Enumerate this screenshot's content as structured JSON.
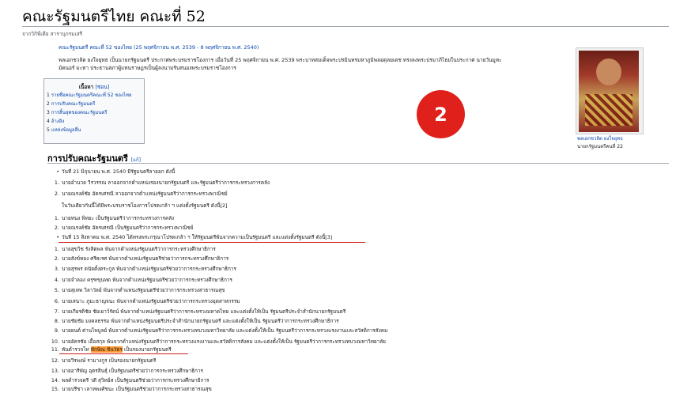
{
  "page": {
    "title": "คณะรัฐมนตรีไทย คณะที่ 52",
    "from": "จากวิกิพีเดีย สารานุกรมเสรี"
  },
  "intro": {
    "p1": "คณะรัฐมนตรี คณะที่ 52 ของไทย (25 พฤศจิกายน พ.ศ. 2539 - 8 พฤศจิกายน พ.ศ. 2540)",
    "p2a": "พลเอกชวลิต ยงใจยุทธ เป็นนายกรัฐมนตรี ประกาศพระบรมราชโองการ เมื่อวันที่ 25 พฤศจิกายน พ.ศ. 2539 พระบาทสมเด็จพระปรมินทรมหาภูมิพลอดุลยเดช ทรงลงพระปรมาภิไธยในประกาศ นายวันมูหะ",
    "p2b": "มัดนอร์ มะทา ประธานสภาผู้แทนราษฎรเป็นผู้ลงนามรับสนองพระบรมราชโองการ"
  },
  "toc": {
    "title": "เนื้อหา",
    "hide": "[ซ่อน]",
    "items": [
      {
        "num": "1",
        "label": "รายชื่อคณะรัฐมนตรีคณะที่ 52 ของไทย"
      },
      {
        "num": "2",
        "label": "การปรับคณะรัฐมนตรี"
      },
      {
        "num": "3",
        "label": "การสิ้นสุดของคณะรัฐมนตรี"
      },
      {
        "num": "4",
        "label": "อ้างอิง"
      },
      {
        "num": "5",
        "label": "แหล่งข้อมูลอื่น"
      }
    ]
  },
  "infobox": {
    "caption": "พลเอกชวลิต ยงใจยุทธ",
    "subcaption": "นายกรัฐมนตรีคนที่ 22"
  },
  "badge": {
    "number": "2"
  },
  "section": {
    "heading": "การปรับคณะรัฐมนตรี",
    "edit": "[แก้]"
  },
  "lines": [
    {
      "mark": "•",
      "text": "วันที่ 21 มิถุนายน พ.ศ. 2540 มีรัฐมนตรีลาออก ดังนี้",
      "kind": "bullet"
    },
    {
      "mark": "1.",
      "text": "นายอำนวย วีรวรรณ ลาออกจากตำแหน่งรองนายกรัฐมนตรี และรัฐมนตรีว่าการกระทรวงการคลัง",
      "kind": "num"
    },
    {
      "mark": "2.",
      "text": "นายณรงค์ชัย อัครเศรณี ลาออกจากตำแหน่งรัฐมนตรีว่าการกระทรวงพาณิชย์",
      "kind": "num"
    },
    {
      "mark": "",
      "text": "ในวันเดียวกันนี้ได้มีพระบรมราชโองการโปรดเกล้า ฯ แต่งตั้งรัฐมนตรี ดังนี้[2]",
      "kind": "plain"
    },
    {
      "mark": "1.",
      "text": "นายทนง พิทยะ เป็นรัฐมนตรีว่าการกระทรวงการคลัง",
      "kind": "num"
    },
    {
      "mark": "2.",
      "text": "นายณรงค์ชัย อัครเศรณี เป็นรัฐมนตรีว่าการกระทรวงพาณิชย์",
      "kind": "num"
    },
    {
      "mark": "•",
      "text": "วันที่ 15 สิงหาคม พ.ศ. 2540 ได้ทรงพระกรุณาโปรดเกล้า ฯ ให้รัฐมนตรีพ้นจากความเป็นรัฐมนตรี และแต่งตั้งรัฐมนตรี ดังนี้[3]",
      "kind": "bullet"
    },
    {
      "mark": "1.",
      "text": "นายสุขวิช รังสิตพล พ้นจากตำแหน่งรัฐมนตรีว่าการกระทรวงศึกษาธิการ",
      "kind": "num"
    },
    {
      "mark": "2.",
      "text": "นายสังข์ทอง ศรีธเรศ พ้นจากตำแหน่งรัฐมนตรีช่วยว่าการกระทรวงศึกษาธิการ",
      "kind": "num"
    },
    {
      "mark": "3.",
      "text": "นายสุรพร ดนัยตั้งตระกูล พ้นจากตำแหน่งรัฐมนตรีช่วยว่าการกระทรวงศึกษาธิการ",
      "kind": "num"
    },
    {
      "mark": "4.",
      "text": "นายจำลอง ครุฑขุนทด พ้นจากตำแหน่งรัฐมนตรีช่วยว่าการกระทรวงศึกษาธิการ",
      "kind": "num"
    },
    {
      "mark": "5.",
      "text": "นายสุเทพ วิลาวัลย์ พ้นจากตำแหน่งรัฐมนตรีช่วยว่าการกระทรวงสาธารณสุข",
      "kind": "num"
    },
    {
      "mark": "6.",
      "text": "นายเสนาะ ภูมะธาญจนะ พ้นจากตำแหน่งรัฐมนตรีช่วยว่าการกระทรวงอุตสาหกรรม",
      "kind": "num"
    },
    {
      "mark": "7.",
      "text": "นายเกียรติชัย ชัยเยาว์รัตน์ พ้นจากตำแหน่งรัฐมนตรีว่าการกระทรวงมหาดไทย และแต่งตั้งให้เป็น รัฐมนตรีประจำสำนักนายกรัฐมนตรี",
      "kind": "num"
    },
    {
      "mark": "8.",
      "text": "นายชัยชัย มงคลธรรม พ้นจากตำแหน่งรัฐมนตรีประจำสำนักนายกรัฐมนตรี และแต่งตั้งให้เป็น รัฐมนตรีว่าการกระทรวงศึกษาธิการ",
      "kind": "num"
    },
    {
      "mark": "9.",
      "text": "นายยนต์ ต่านไพบูลย์ พ้นจากตำแหน่งรัฐมนตรีว่าการกระทรวงทบวงมหาวิทยาลัย และแต่งตั้งให้เป็น รัฐมนตรีว่าการกระทรวงแรงงานและสวัสดิการสังคม",
      "kind": "num"
    },
    {
      "mark": "10.",
      "text": "นายอัครชัย เอื้อสกุล พ้นจากตำแหน่งรัฐมนตรีว่าการกระทรวงแรงงานและสวัสดิการสังคม และแต่งตั้งให้เป็น รัฐมนตรีว่าการกระทรวงทบวงมหาวิทยาลัย",
      "kind": "num"
    },
    {
      "mark": "11.",
      "pre": "พันตำรวจโท ",
      "hl": "ทักษิณ ชินวัตร",
      "post": " เป็นรองนายกรัฐมนตรี",
      "kind": "num-hl"
    },
    {
      "mark": "12.",
      "text": "นายวีรพงษ์ รามางกูร เป็นรองนายกรัฐมนตรี",
      "kind": "num"
    },
    {
      "mark": "13.",
      "text": "นายอารีพัญ อุตรสินธุ์ เป็นรัฐมนตรีช่วยว่าการกระทรวงศึกษาธิการ",
      "kind": "num"
    },
    {
      "mark": "14.",
      "text": "พลตำรวจตรี วดี สุวิทย์ส เป็นรัฐมนตรีช่วยว่าการกระทรวงศึกษาธิการ",
      "kind": "num"
    },
    {
      "mark": "15.",
      "text": "นายปรีชา เลาหพงศ์ชนะ เป็นรัฐมนตรีช่วยว่าการกระทรวงสาธารณสุข",
      "kind": "num"
    }
  ]
}
